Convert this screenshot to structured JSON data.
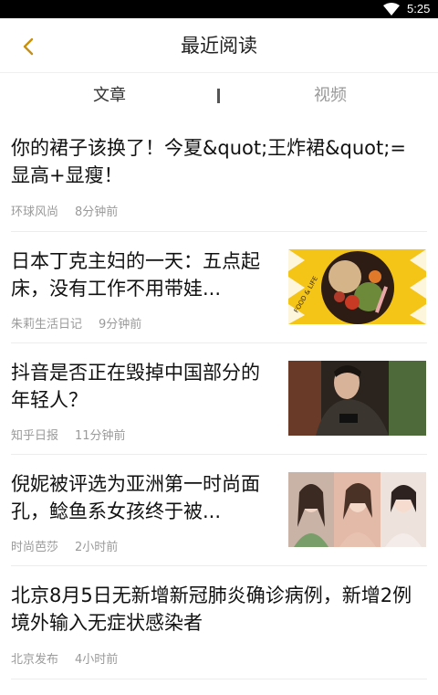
{
  "status_bar": {
    "time": "5:25",
    "wifi_icon": "wifi-icon"
  },
  "header": {
    "title": "最近阅读",
    "back_icon": "chevron-left-icon"
  },
  "tabs": [
    {
      "label": "文章",
      "active": true
    },
    {
      "label": "视频",
      "active": false
    }
  ],
  "articles": [
    {
      "title": "你的裙子该换了！今夏&quot;王炸裙&quot;=显高+显瘦！",
      "source": "环球风尚",
      "time": "8分钟前",
      "has_thumb": false
    },
    {
      "title": "日本丁克主妇的一天：五点起床，没有工作不用带娃...",
      "source": "朱莉生活日记",
      "time": "9分钟前",
      "has_thumb": true,
      "thumb_text": "FOOD & LIFE"
    },
    {
      "title": "抖音是否正在毁掉中国部分的年轻人？",
      "source": "知乎日报",
      "time": "11分钟前",
      "has_thumb": true
    },
    {
      "title": "倪妮被评选为亚洲第一时尚面孔，鲶鱼系女孩终于被...",
      "source": "时尚芭莎",
      "time": "2小时前",
      "has_thumb": true
    },
    {
      "title": "北京8月5日无新增新冠肺炎确诊病例，新增2例境外输入无症状感染者",
      "source": "北京发布",
      "time": "4小时前",
      "has_thumb": false
    }
  ],
  "colors": {
    "accent": "#d9a31a",
    "text": "#222222",
    "meta": "#9a9a9a",
    "divider": "#ececec"
  }
}
